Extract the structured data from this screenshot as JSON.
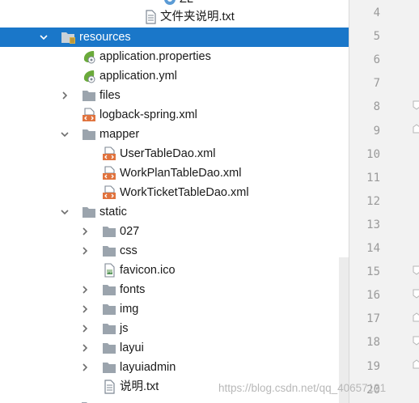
{
  "project_tree": {
    "partial_top_label": "ZL",
    "items": [
      {
        "label": "文件夹说明.txt",
        "icon": "text-file-icon",
        "arrow": "none"
      },
      {
        "label": "resources",
        "icon": "resources-folder-icon",
        "arrow": "expanded",
        "selected": true
      },
      {
        "label": "application.properties",
        "icon": "spring-config-icon",
        "arrow": "none"
      },
      {
        "label": "application.yml",
        "icon": "spring-config-icon",
        "arrow": "none"
      },
      {
        "label": "files",
        "icon": "folder-icon",
        "arrow": "collapsed"
      },
      {
        "label": "logback-spring.xml",
        "icon": "xml-file-icon",
        "arrow": "none"
      },
      {
        "label": "mapper",
        "icon": "folder-icon",
        "arrow": "expanded"
      },
      {
        "label": "UserTableDao.xml",
        "icon": "xml-file-icon",
        "arrow": "none"
      },
      {
        "label": "WorkPlanTableDao.xml",
        "icon": "xml-file-icon",
        "arrow": "none"
      },
      {
        "label": "WorkTicketTableDao.xml",
        "icon": "xml-file-icon",
        "arrow": "none"
      },
      {
        "label": "static",
        "icon": "folder-icon",
        "arrow": "expanded"
      },
      {
        "label": "027",
        "icon": "folder-icon",
        "arrow": "collapsed"
      },
      {
        "label": "css",
        "icon": "folder-icon",
        "arrow": "collapsed"
      },
      {
        "label": "favicon.ico",
        "icon": "image-file-icon",
        "arrow": "none"
      },
      {
        "label": "fonts",
        "icon": "folder-icon",
        "arrow": "collapsed"
      },
      {
        "label": "img",
        "icon": "folder-icon",
        "arrow": "collapsed"
      },
      {
        "label": "js",
        "icon": "folder-icon",
        "arrow": "collapsed"
      },
      {
        "label": "layui",
        "icon": "folder-icon",
        "arrow": "collapsed"
      },
      {
        "label": "layuiadmin",
        "icon": "folder-icon",
        "arrow": "collapsed"
      },
      {
        "label": "说明.txt",
        "icon": "text-file-icon",
        "arrow": "none"
      }
    ]
  },
  "editor_gutter": {
    "line_numbers": [
      "4",
      "5",
      "6",
      "7",
      "8",
      "9",
      "10",
      "11",
      "12",
      "13",
      "14",
      "15",
      "16",
      "17",
      "18",
      "19",
      "20"
    ]
  },
  "watermark": "https://blog.csdn.net/qq_40657131",
  "colors": {
    "selection": "#1a77c9",
    "folder": "#9ba4ad",
    "xml_orange": "#e0733e",
    "spring_green": "#6aaa3a"
  }
}
